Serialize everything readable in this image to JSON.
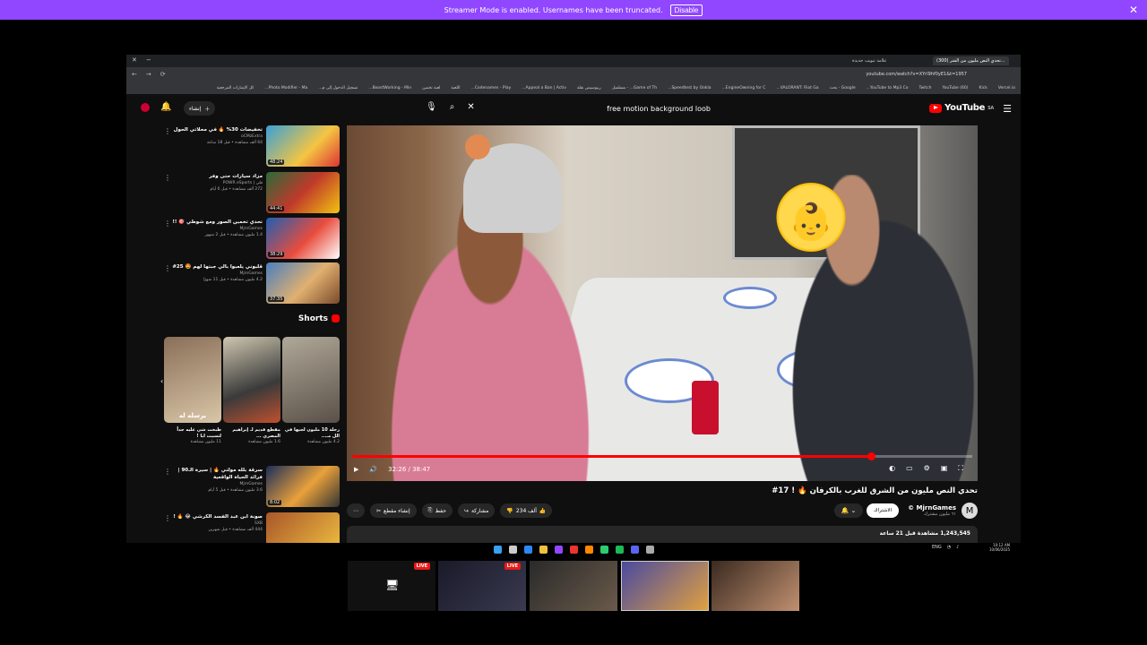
{
  "banner": {
    "text": "Streamer Mode is enabled. Usernames have been truncated.",
    "button": "Disable",
    "close": "✕"
  },
  "browser": {
    "tabs": [
      {
        "label": "(300) تحدي النص مليون من الشر...",
        "active": true
      },
      {
        "label": "علامة تبويب جديدة",
        "active": false
      }
    ],
    "url": "youtube.com/watch?v=XYrl9hf0yE1&t=1957",
    "bookmarks": [
      "Vercel.io",
      "Kick",
      "(60) YouTube",
      "Twitch",
      "YouTube to Mp3 Co...",
      "Google - بحث",
      "VALORANT: Riot Ga...",
      "EngineOwning for C...",
      "Speedtest by Ookla...",
      "Game of Th... - مسلسل",
      "ريبوسيس نقلة",
      "Appeal a Ban | Activ...",
      "Codenames - Play...",
      "اللعبة",
      "لعبة تخمين",
      "BoostWorking - Min...",
      "تسجيل الدخول إلى م...",
      "Photo Modifier - Ma...",
      "كل الإشارات المرجعية"
    ]
  },
  "yt": {
    "logo": "YouTube",
    "logo_sup": "SA",
    "search_query": "free motion background loob",
    "create": "إنشاء",
    "video": {
      "time": "32:26 / 38:47",
      "progress_pct": 83.6
    },
    "title": "تحدي النص مليون من الشرق للغرب بالكرفان 🔥 ! 17#",
    "channel": {
      "name": "MjrnGames ©",
      "subs": "٦١ مليون مشترك",
      "avatar": "M"
    },
    "subscribe": "الاشتراك",
    "likes": "234 ألف",
    "share": "مشاركة",
    "save": "حفظ",
    "clip": "إنشاء مقطع",
    "description": "1,243,545 مشاهدة قبل 21 ساعة"
  },
  "related": [
    {
      "title": "تخفيضات 30% 🔥 في محلاتي الحول",
      "channel": "oCMzExtra",
      "views": "64 ألف مشاهدة • قبل 18 ساعة",
      "duration": "48:24"
    },
    {
      "title": "مزاد سيارات حتى وفر",
      "channel": "فلي | POWR eSports",
      "views": "272 ألف مشاهدة • قبل 6 أيام",
      "duration": "44:41"
    },
    {
      "title": "تحدي تخمين الصور ومع شوطي 🎯 !!",
      "channel": "MjrnGames",
      "views": "1.4 مليون مشاهدة • قبل 2 شهور",
      "duration": "38:29"
    },
    {
      "title": "قلبوني يلعبوا بالي جبتها لهم 🤩 25#",
      "channel": "MjrnGames",
      "views": "4.2 مليون مشاهدة • قبل 11 شهرًا",
      "duration": "37:35"
    }
  ],
  "shorts": {
    "heading": "Shorts",
    "items": [
      {
        "title": "رحلة 10 مليون لجيها في الل مـ...",
        "views": "4.2 مليون مشاهدة",
        "overlay": ""
      },
      {
        "title": "مقطع قديم لـ إبراهيم المصري ...",
        "views": "1.6 مليون مشاهدة",
        "overlay": ""
      },
      {
        "title": "طبخت شي عليه جداً لتسيت ابا !",
        "views": "11 مليون مشاهدة",
        "overlay": "برسله له"
      }
    ]
  },
  "related2": [
    {
      "title": "سرقة بلله مولتي 🔥 | سيرة الـ90 | فرائد الحياة الواقعية",
      "channel": "MjrnGames",
      "views": "3.6 مليون مشاهدة • قبل 5 أيام",
      "duration": "8:02"
    },
    {
      "title": "صونة ابن عبد الفسد الكرشي 😂 🔥 !",
      "channel": "SXB",
      "views": "444 ألف مشاهدة • قبل شهرين",
      "duration": ""
    }
  ],
  "system": {
    "time": "10:12 AM",
    "date": "10/06/2025",
    "lang": "ENG"
  },
  "streams": [
    {
      "live": "LIVE"
    },
    {
      "live": "LIVE"
    },
    {
      "live": ""
    },
    {
      "live": ""
    },
    {
      "live": ""
    }
  ],
  "colors": {
    "banner": "#9147ff",
    "yt_red": "#ff0000",
    "live_red": "#e91916"
  }
}
